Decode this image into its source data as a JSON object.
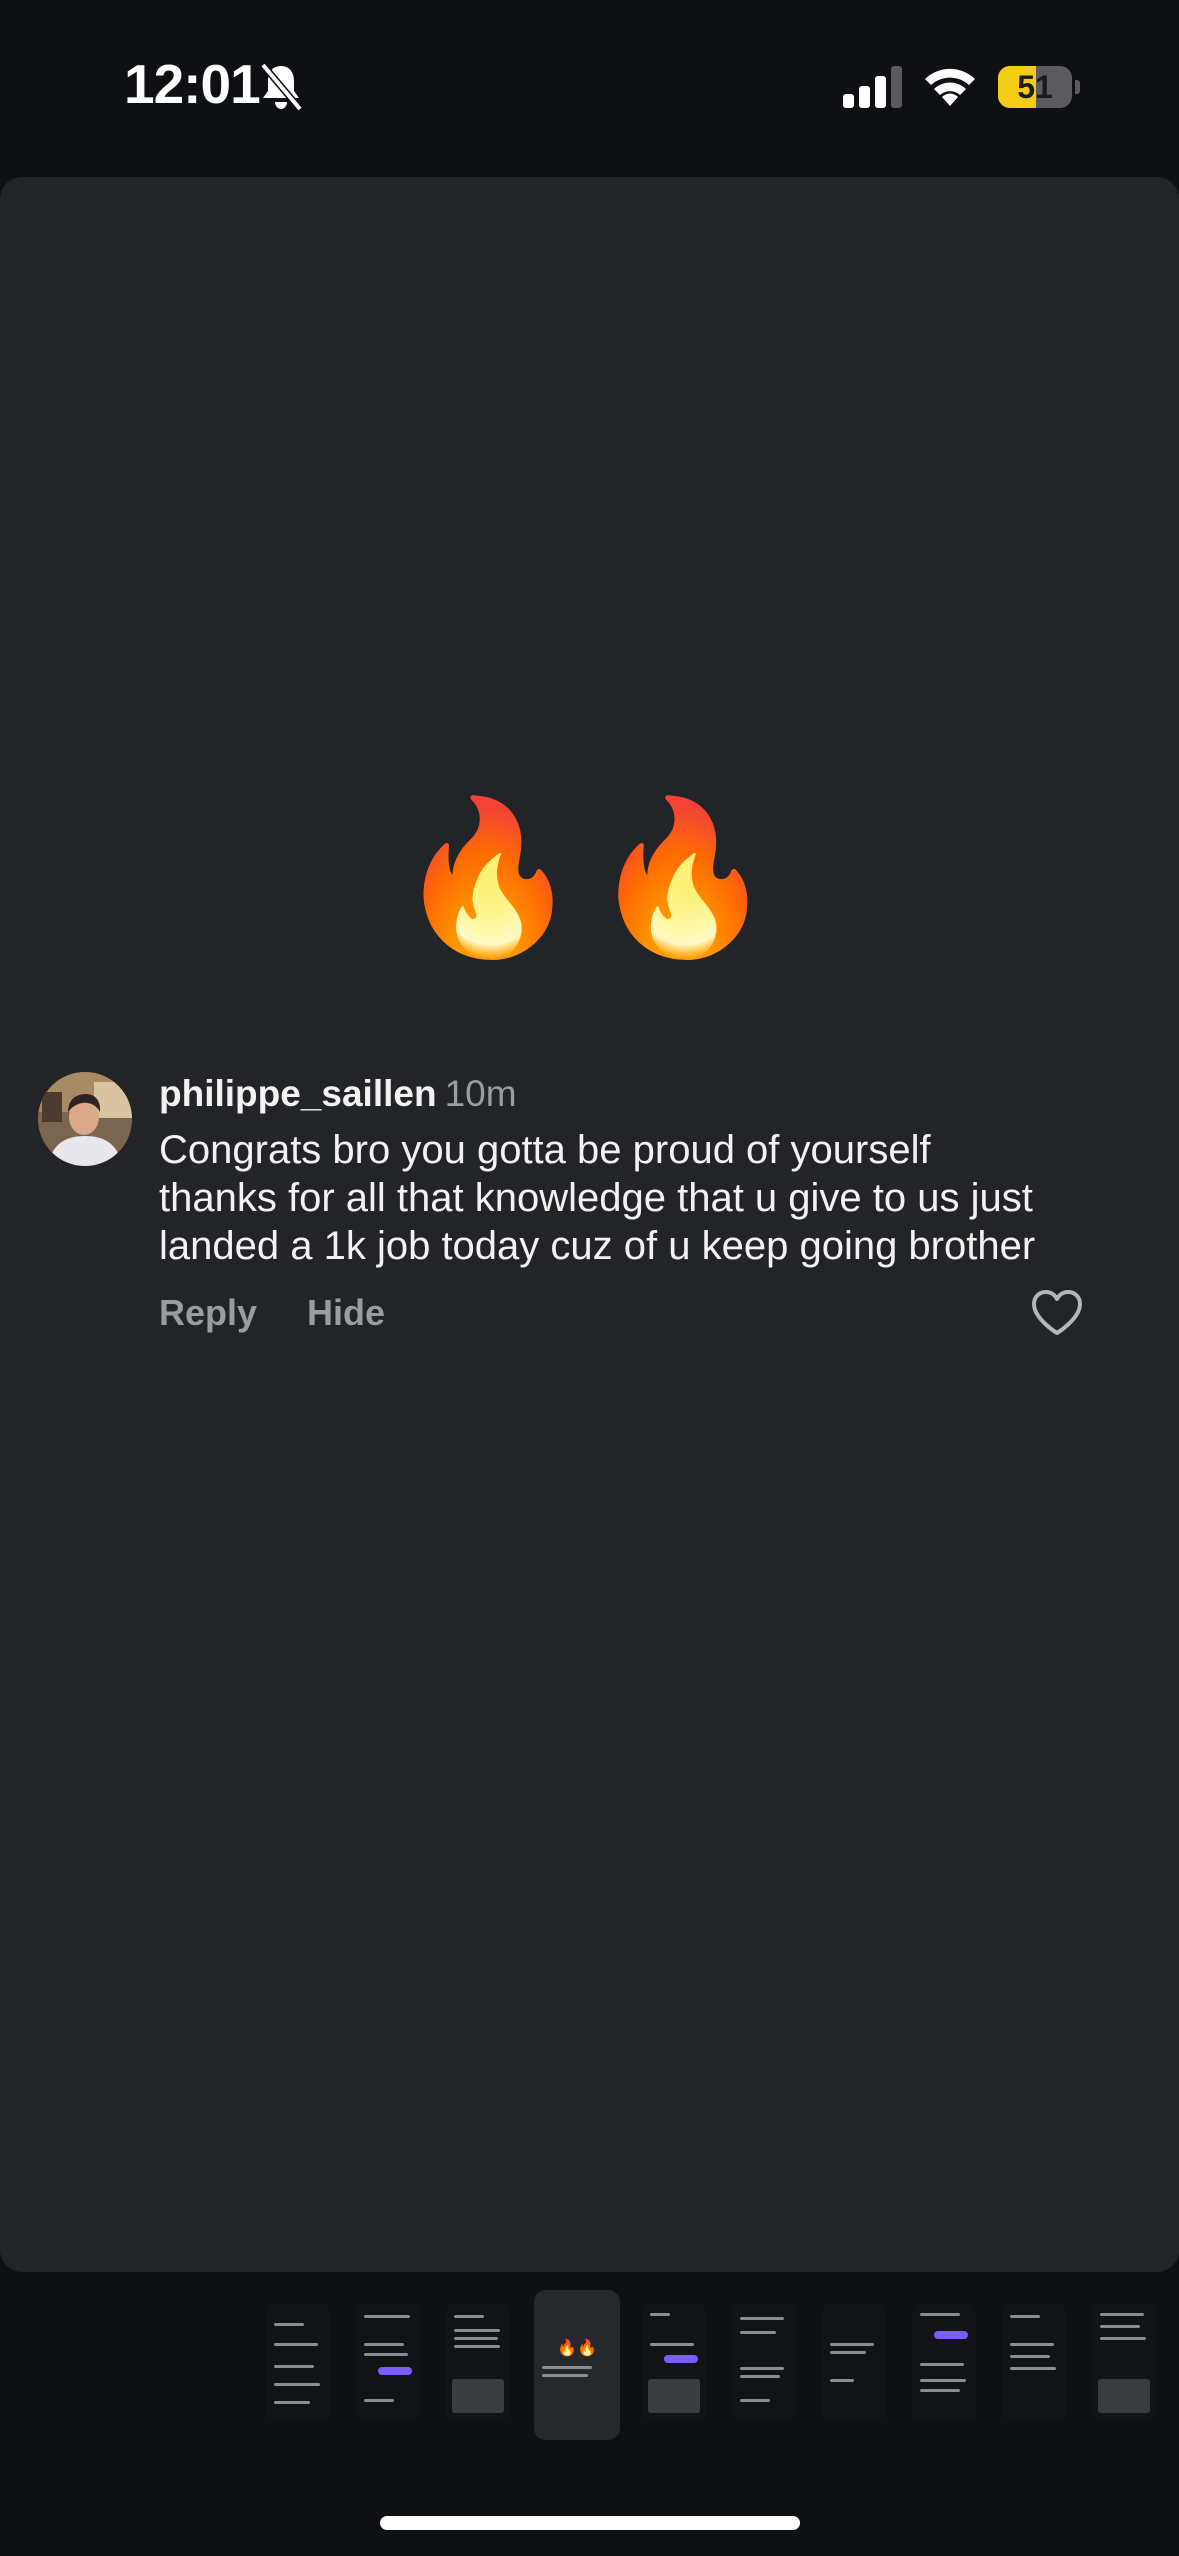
{
  "status_bar": {
    "time": "12:01",
    "battery_level": "51",
    "battery_percent": 51,
    "silent_mode": true,
    "icons": [
      "bell-slash-icon",
      "cellular-signal-icon",
      "wifi-icon",
      "battery-icon"
    ]
  },
  "post": {
    "emoji": "🔥🔥"
  },
  "comment": {
    "username": "philippe_saillen",
    "time_ago": "10m",
    "text": "Congrats bro you gotta be proud of yourself thanks for all that knowledge that u give to us just landed a 1k job today cuz of u keep going brother",
    "reply_label": "Reply",
    "hide_label": "Hide",
    "like_icon": "heart-outline-icon"
  },
  "thumbnails": {
    "count": 10,
    "active_index": 3,
    "active_emoji": "🔥🔥"
  },
  "colors": {
    "background": "#0e1014",
    "card": "#222427",
    "muted_text": "#9a9ca1",
    "battery_yellow": "#f5cc14"
  }
}
